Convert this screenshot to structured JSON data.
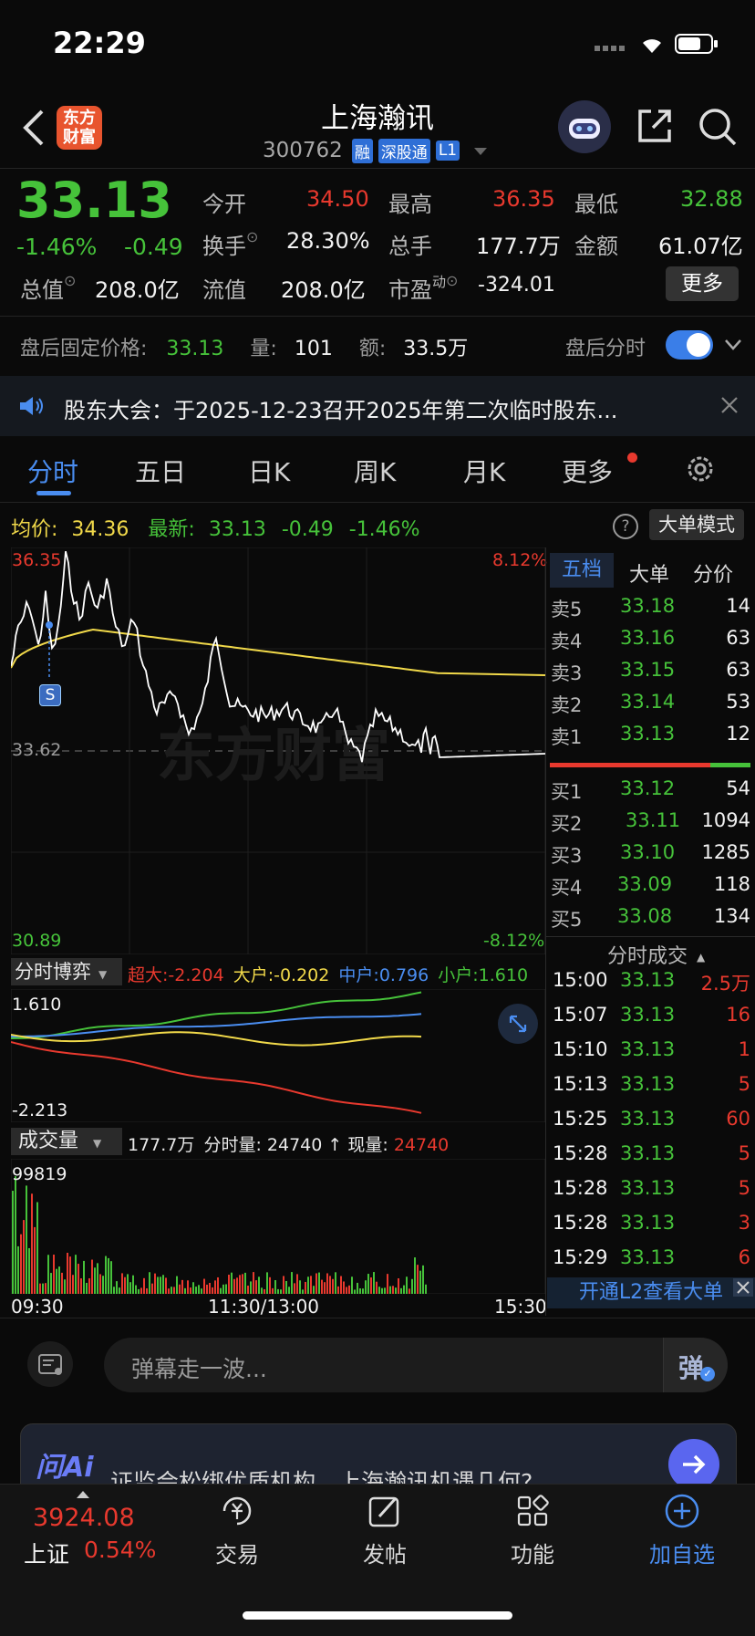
{
  "status_bar": {
    "time": "22:29"
  },
  "header": {
    "title": "上海瀚讯",
    "code": "300762",
    "tags": [
      "融",
      "深股通",
      "L1"
    ],
    "logo_text": [
      "东方",
      "财富"
    ]
  },
  "quote": {
    "price": "33.13",
    "change_pct": "-1.46%",
    "change": "-0.49",
    "open_label": "今开",
    "open": "34.50",
    "high_label": "最高",
    "high": "36.35",
    "low_label": "最低",
    "low": "32.88",
    "turnover_label": "换手",
    "turnover": "28.30%",
    "volume_label": "总手",
    "volume": "177.7万",
    "amount_label": "金额",
    "amount": "61.07亿",
    "mcap_label": "总值",
    "mcap": "208.0亿",
    "float_label": "流值",
    "float": "208.0亿",
    "pe_label": "市盈",
    "pe_sup": "动",
    "pe": "-324.01",
    "more_button": "更多"
  },
  "after_hours": {
    "label": "盘后固定价格:",
    "price": "33.13",
    "vol_label": "量:",
    "vol": "101",
    "amt_label": "额:",
    "amt": "33.5万",
    "toggle_label": "盘后分时"
  },
  "notice": {
    "text": "股东大会：于2025-12-23召开2025年第二次临时股东..."
  },
  "tabs": [
    "分时",
    "五日",
    "日K",
    "周K",
    "月K",
    "更多"
  ],
  "chart_header": {
    "avg_label": "均价:",
    "avg": "34.36",
    "last_label": "最新:",
    "last": "33.13",
    "chg": "-0.49",
    "pct": "-1.46%",
    "mode_button": "大单模式"
  },
  "price_axis": {
    "top": "36.35",
    "mid": "33.62",
    "bottom": "30.89",
    "top_pct": "8.12%",
    "bottom_pct": "-8.12%"
  },
  "s_marker": "S",
  "watermark": "东方财富",
  "flow": {
    "dropdown": "分时博弈",
    "super_label": "超大:",
    "super": "-2.204",
    "large_label": "大户:",
    "large": "-0.202",
    "mid_label": "中户:",
    "mid": "0.796",
    "small_label": "小户:",
    "small": "1.610",
    "axis_top": "1.610",
    "axis_bottom": "-2.213"
  },
  "volume_panel": {
    "dropdown": "成交量",
    "total": "177.7万",
    "period_label": "分时量:",
    "period": "24740",
    "now_label": "现量:",
    "now": "24740",
    "axis_top": "99819",
    "time_start": "09:30",
    "time_mid": "11:30/13:00",
    "time_end": "15:30"
  },
  "order_book": {
    "tabs": [
      "五档",
      "大单",
      "分价"
    ],
    "asks": [
      {
        "label": "卖5",
        "price": "33.18",
        "vol": "14"
      },
      {
        "label": "卖4",
        "price": "33.16",
        "vol": "63"
      },
      {
        "label": "卖3",
        "price": "33.15",
        "vol": "63"
      },
      {
        "label": "卖2",
        "price": "33.14",
        "vol": "53"
      },
      {
        "label": "卖1",
        "price": "33.13",
        "vol": "12"
      }
    ],
    "bids": [
      {
        "label": "买1",
        "price": "33.12",
        "vol": "54"
      },
      {
        "label": "买2",
        "price": "33.11",
        "vol": "1094"
      },
      {
        "label": "买3",
        "price": "33.10",
        "vol": "1285"
      },
      {
        "label": "买4",
        "price": "33.09",
        "vol": "118"
      },
      {
        "label": "买5",
        "price": "33.08",
        "vol": "134"
      }
    ]
  },
  "trades": {
    "title": "分时成交",
    "rows": [
      {
        "time": "15:00",
        "price": "33.13",
        "vol": "2.5万"
      },
      {
        "time": "15:07",
        "price": "33.13",
        "vol": "16"
      },
      {
        "time": "15:10",
        "price": "33.13",
        "vol": "1"
      },
      {
        "time": "15:13",
        "price": "33.13",
        "vol": "5"
      },
      {
        "time": "15:25",
        "price": "33.13",
        "vol": "60"
      },
      {
        "time": "15:28",
        "price": "33.13",
        "vol": "5"
      },
      {
        "time": "15:28",
        "price": "33.13",
        "vol": "5"
      },
      {
        "time": "15:28",
        "price": "33.13",
        "vol": "3"
      },
      {
        "time": "15:29",
        "price": "33.13",
        "vol": "6"
      }
    ],
    "l2_button": "开通L2查看大单"
  },
  "danmu": {
    "placeholder": "弹幕走一波...",
    "button": "弹"
  },
  "ai_banner": {
    "logo": "问Ai",
    "text": "证监会松绑优质机构，上海瀚讯机遇几何?"
  },
  "bottom_nav": {
    "index_value": "3924.08",
    "index_name": "上证",
    "index_pct": "0.54%",
    "trade": "交易",
    "post": "发帖",
    "func": "功能",
    "add": "加自选"
  },
  "colors": {
    "up": "#e8392e",
    "down": "#46c23a",
    "accent": "#4a8df0",
    "avg_line": "#f1d94a"
  }
}
